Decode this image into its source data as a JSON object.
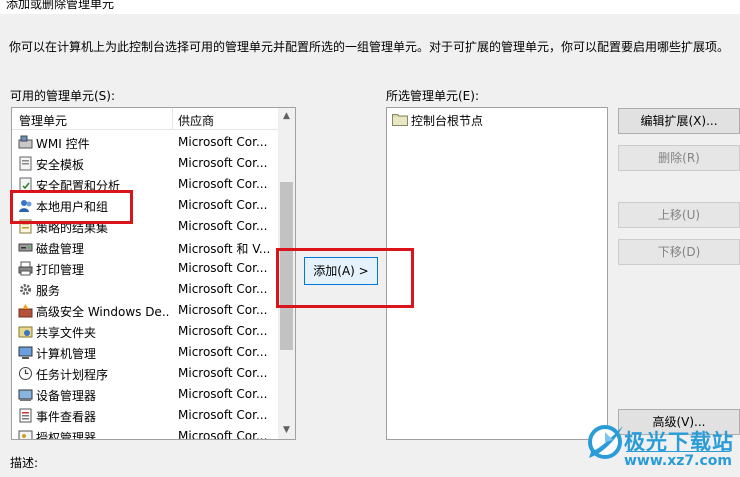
{
  "dialog": {
    "title": "添加或删除管理单元",
    "description": "你可以在计算机上为此控制台选择可用的管理单元并配置所选的一组管理单元。对于可扩展的管理单元，你可以配置要启用哪些扩展项。"
  },
  "available": {
    "label": "可用的管理单元(S):",
    "col_name": "管理单元",
    "col_vendor": "供应商",
    "items": [
      {
        "name": "WMI 控件",
        "vendor": "Microsoft Cor...",
        "icon": "wmi-control-icon"
      },
      {
        "name": "安全模板",
        "vendor": "Microsoft Cor...",
        "icon": "security-templates-icon"
      },
      {
        "name": "安全配置和分析",
        "vendor": "Microsoft Cor...",
        "icon": "security-config-icon"
      },
      {
        "name": "本地用户和组",
        "vendor": "Microsoft Cor...",
        "icon": "local-users-groups-icon"
      },
      {
        "name": "策略的结果集",
        "vendor": "Microsoft Cor...",
        "icon": "policy-results-icon"
      },
      {
        "name": "磁盘管理",
        "vendor": "Microsoft 和 V...",
        "icon": "disk-management-icon"
      },
      {
        "name": "打印管理",
        "vendor": "Microsoft Cor...",
        "icon": "print-management-icon"
      },
      {
        "name": "服务",
        "vendor": "Microsoft Cor...",
        "icon": "services-gear-icon"
      },
      {
        "name": "高级安全 Windows De...",
        "vendor": "Microsoft Cor...",
        "icon": "firewall-icon"
      },
      {
        "name": "共享文件夹",
        "vendor": "Microsoft Cor...",
        "icon": "shared-folders-icon"
      },
      {
        "name": "计算机管理",
        "vendor": "Microsoft Cor...",
        "icon": "computer-management-icon"
      },
      {
        "name": "任务计划程序",
        "vendor": "Microsoft Cor...",
        "icon": "task-scheduler-icon"
      },
      {
        "name": "设备管理器",
        "vendor": "Microsoft Cor...",
        "icon": "device-manager-icon"
      },
      {
        "name": "事件查看器",
        "vendor": "Microsoft Cor...",
        "icon": "event-viewer-icon"
      },
      {
        "name": "授权管理器",
        "vendor": "Microsoft Cor...",
        "icon": "authorization-manager-icon"
      }
    ]
  },
  "add_button": "添加(A) >",
  "selected": {
    "label": "所选管理单元(E):",
    "root": "控制台根节点"
  },
  "buttons": {
    "edit_extensions": "编辑扩展(X)...",
    "remove": "删除(R)",
    "move_up": "上移(U)",
    "move_down": "下移(D)",
    "advanced": "高级(V)..."
  },
  "footer": {
    "description_label": "描述:"
  },
  "watermark": {
    "brand": "极光下载站",
    "url": "www.xz7.com"
  },
  "colors": {
    "highlight_box": "#d9151b",
    "watermark": "#2a9cd8",
    "add_button_border": "#0078d7"
  }
}
